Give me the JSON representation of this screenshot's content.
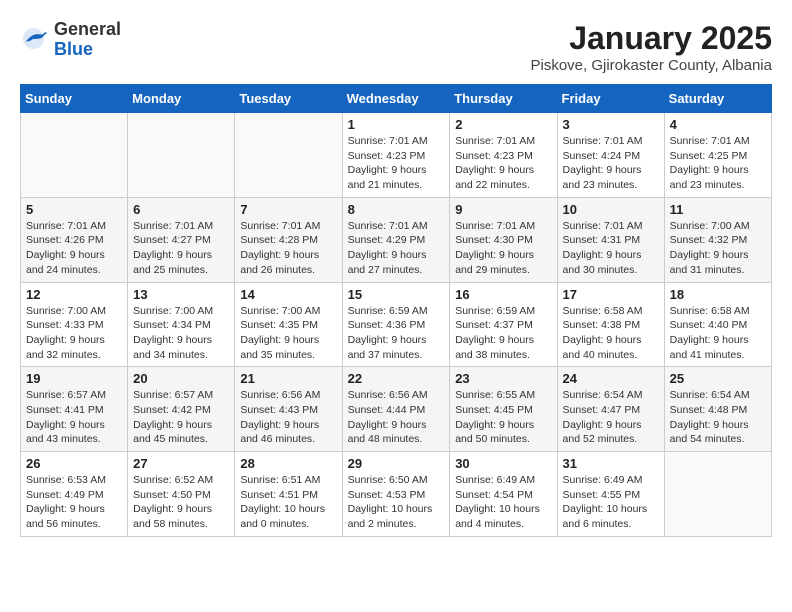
{
  "logo": {
    "general": "General",
    "blue": "Blue"
  },
  "header": {
    "title": "January 2025",
    "subtitle": "Piskove, Gjirokaster County, Albania"
  },
  "weekdays": [
    "Sunday",
    "Monday",
    "Tuesday",
    "Wednesday",
    "Thursday",
    "Friday",
    "Saturday"
  ],
  "weeks": [
    [
      {
        "day": "",
        "info": ""
      },
      {
        "day": "",
        "info": ""
      },
      {
        "day": "",
        "info": ""
      },
      {
        "day": "1",
        "info": "Sunrise: 7:01 AM\nSunset: 4:23 PM\nDaylight: 9 hours\nand 21 minutes."
      },
      {
        "day": "2",
        "info": "Sunrise: 7:01 AM\nSunset: 4:23 PM\nDaylight: 9 hours\nand 22 minutes."
      },
      {
        "day": "3",
        "info": "Sunrise: 7:01 AM\nSunset: 4:24 PM\nDaylight: 9 hours\nand 23 minutes."
      },
      {
        "day": "4",
        "info": "Sunrise: 7:01 AM\nSunset: 4:25 PM\nDaylight: 9 hours\nand 23 minutes."
      }
    ],
    [
      {
        "day": "5",
        "info": "Sunrise: 7:01 AM\nSunset: 4:26 PM\nDaylight: 9 hours\nand 24 minutes."
      },
      {
        "day": "6",
        "info": "Sunrise: 7:01 AM\nSunset: 4:27 PM\nDaylight: 9 hours\nand 25 minutes."
      },
      {
        "day": "7",
        "info": "Sunrise: 7:01 AM\nSunset: 4:28 PM\nDaylight: 9 hours\nand 26 minutes."
      },
      {
        "day": "8",
        "info": "Sunrise: 7:01 AM\nSunset: 4:29 PM\nDaylight: 9 hours\nand 27 minutes."
      },
      {
        "day": "9",
        "info": "Sunrise: 7:01 AM\nSunset: 4:30 PM\nDaylight: 9 hours\nand 29 minutes."
      },
      {
        "day": "10",
        "info": "Sunrise: 7:01 AM\nSunset: 4:31 PM\nDaylight: 9 hours\nand 30 minutes."
      },
      {
        "day": "11",
        "info": "Sunrise: 7:00 AM\nSunset: 4:32 PM\nDaylight: 9 hours\nand 31 minutes."
      }
    ],
    [
      {
        "day": "12",
        "info": "Sunrise: 7:00 AM\nSunset: 4:33 PM\nDaylight: 9 hours\nand 32 minutes."
      },
      {
        "day": "13",
        "info": "Sunrise: 7:00 AM\nSunset: 4:34 PM\nDaylight: 9 hours\nand 34 minutes."
      },
      {
        "day": "14",
        "info": "Sunrise: 7:00 AM\nSunset: 4:35 PM\nDaylight: 9 hours\nand 35 minutes."
      },
      {
        "day": "15",
        "info": "Sunrise: 6:59 AM\nSunset: 4:36 PM\nDaylight: 9 hours\nand 37 minutes."
      },
      {
        "day": "16",
        "info": "Sunrise: 6:59 AM\nSunset: 4:37 PM\nDaylight: 9 hours\nand 38 minutes."
      },
      {
        "day": "17",
        "info": "Sunrise: 6:58 AM\nSunset: 4:38 PM\nDaylight: 9 hours\nand 40 minutes."
      },
      {
        "day": "18",
        "info": "Sunrise: 6:58 AM\nSunset: 4:40 PM\nDaylight: 9 hours\nand 41 minutes."
      }
    ],
    [
      {
        "day": "19",
        "info": "Sunrise: 6:57 AM\nSunset: 4:41 PM\nDaylight: 9 hours\nand 43 minutes."
      },
      {
        "day": "20",
        "info": "Sunrise: 6:57 AM\nSunset: 4:42 PM\nDaylight: 9 hours\nand 45 minutes."
      },
      {
        "day": "21",
        "info": "Sunrise: 6:56 AM\nSunset: 4:43 PM\nDaylight: 9 hours\nand 46 minutes."
      },
      {
        "day": "22",
        "info": "Sunrise: 6:56 AM\nSunset: 4:44 PM\nDaylight: 9 hours\nand 48 minutes."
      },
      {
        "day": "23",
        "info": "Sunrise: 6:55 AM\nSunset: 4:45 PM\nDaylight: 9 hours\nand 50 minutes."
      },
      {
        "day": "24",
        "info": "Sunrise: 6:54 AM\nSunset: 4:47 PM\nDaylight: 9 hours\nand 52 minutes."
      },
      {
        "day": "25",
        "info": "Sunrise: 6:54 AM\nSunset: 4:48 PM\nDaylight: 9 hours\nand 54 minutes."
      }
    ],
    [
      {
        "day": "26",
        "info": "Sunrise: 6:53 AM\nSunset: 4:49 PM\nDaylight: 9 hours\nand 56 minutes."
      },
      {
        "day": "27",
        "info": "Sunrise: 6:52 AM\nSunset: 4:50 PM\nDaylight: 9 hours\nand 58 minutes."
      },
      {
        "day": "28",
        "info": "Sunrise: 6:51 AM\nSunset: 4:51 PM\nDaylight: 10 hours\nand 0 minutes."
      },
      {
        "day": "29",
        "info": "Sunrise: 6:50 AM\nSunset: 4:53 PM\nDaylight: 10 hours\nand 2 minutes."
      },
      {
        "day": "30",
        "info": "Sunrise: 6:49 AM\nSunset: 4:54 PM\nDaylight: 10 hours\nand 4 minutes."
      },
      {
        "day": "31",
        "info": "Sunrise: 6:49 AM\nSunset: 4:55 PM\nDaylight: 10 hours\nand 6 minutes."
      },
      {
        "day": "",
        "info": ""
      }
    ]
  ]
}
